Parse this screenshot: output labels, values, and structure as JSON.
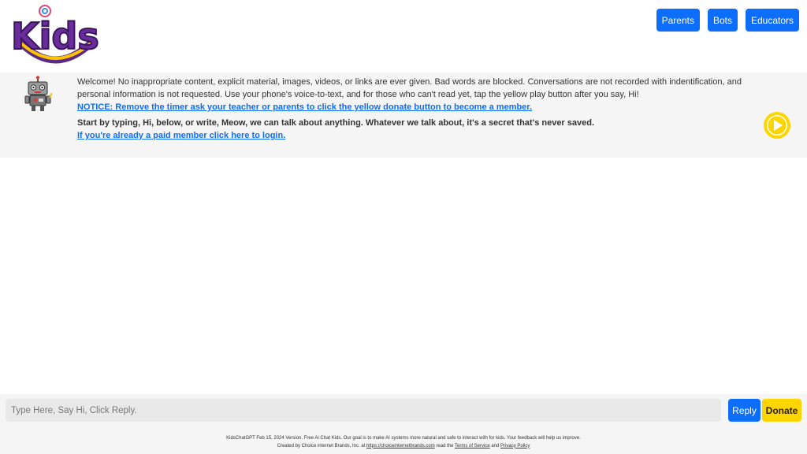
{
  "header": {
    "logo_text": "Kids",
    "nav": {
      "parents": "Parents",
      "bots": "Bots",
      "educators": "Educators"
    }
  },
  "welcome": {
    "intro": "Welcome! No inappropriate content, explicit material, images, videos, or links are ever given. Bad words are blocked. Conversations are not recorded with indentification, and personal information is not requested. Use your phone's voice-to-text, and for those who can't read yet, tap the yellow play button after you say, Hi!",
    "notice_link": "NOTICE: Remove the timer ask your teacher or parents to click the yellow donate button to become a member.",
    "start_text": "Start by typing, Hi, below, or write, Meow, we can talk about anything. Whatever we talk about, it's a secret that's never saved.",
    "login_link": "If you're already a paid member click here to login."
  },
  "composer": {
    "placeholder": "Type Here, Say Hi, Click Reply.",
    "reply_label": "Reply",
    "donate_label": "Donate"
  },
  "footer": {
    "line1": "KidsChatGPT Feb 15, 2024 Version. Free Ai Chat Kids. Our goal is to make AI systems more natural and safe to interact with for kids. Your feedback will help us improve.",
    "line2_prefix": "Created by Choice internet Brands, Inc. at",
    "site_link": "https://choiceinternetbrands.com",
    "line2_mid": "read the",
    "terms_link": "Terms of Service",
    "and": "and",
    "privacy_link": "Privacy Policy"
  },
  "colors": {
    "primary": "#0d6efd",
    "donate": "#ffd500",
    "panel": "#f5f5f5"
  }
}
